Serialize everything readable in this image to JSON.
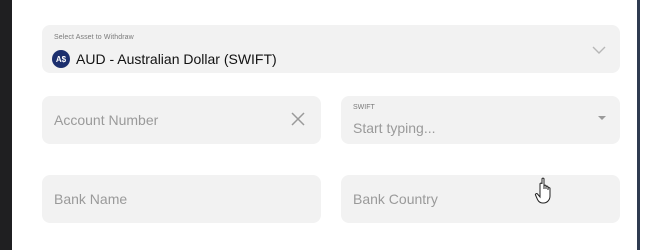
{
  "asset": {
    "label": "Select Asset to Withdraw",
    "currency_badge": "A$",
    "selected": "AUD - Australian Dollar (SWIFT)",
    "dropdown_icon": "chevron-down-icon"
  },
  "account_number": {
    "placeholder": "Account Number",
    "clear_icon": "close-icon"
  },
  "swift": {
    "label": "SWIFT",
    "placeholder": "Start typing...",
    "dropdown_icon": "caret-down-icon"
  },
  "bank_name": {
    "placeholder": "Bank Name"
  },
  "bank_country": {
    "placeholder": "Bank Country"
  },
  "cursor_icon": "hand-pointer-icon",
  "colors": {
    "field_bg": "#f2f2f2",
    "badge_bg": "#1c2f6e",
    "placeholder": "#9a9a9a",
    "text": "#121212",
    "accent_edge": "#2f3b50"
  }
}
